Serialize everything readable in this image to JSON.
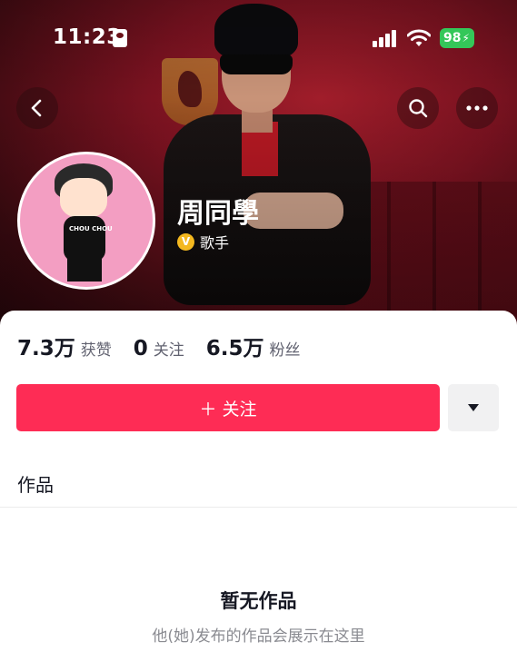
{
  "status_bar": {
    "time": "11:23",
    "battery": "98",
    "icons": [
      "id-card-icon",
      "signal-icon",
      "wifi-icon",
      "battery-icon"
    ]
  },
  "nav": {
    "icons": [
      "back-icon",
      "search-icon",
      "more-icon"
    ]
  },
  "profile": {
    "name": "周同學",
    "verify_badge": "V",
    "title": "歌手",
    "avatar_text": "CHOU CHOU"
  },
  "stats": [
    {
      "value": "7.3万",
      "label": "获赞"
    },
    {
      "value": "0",
      "label": "关注"
    },
    {
      "value": "6.5万",
      "label": "粉丝"
    }
  ],
  "actions": {
    "follow_label": "＋ 关注",
    "dropdown_icon": "caret-down-icon"
  },
  "tabs": {
    "works": "作品"
  },
  "empty_state": {
    "title": "暂无作品",
    "subtitle": "他(她)发布的作品会展示在这里"
  },
  "colors": {
    "accent": "#fe2c55",
    "verify": "#f4b81f",
    "battery": "#34c759"
  }
}
